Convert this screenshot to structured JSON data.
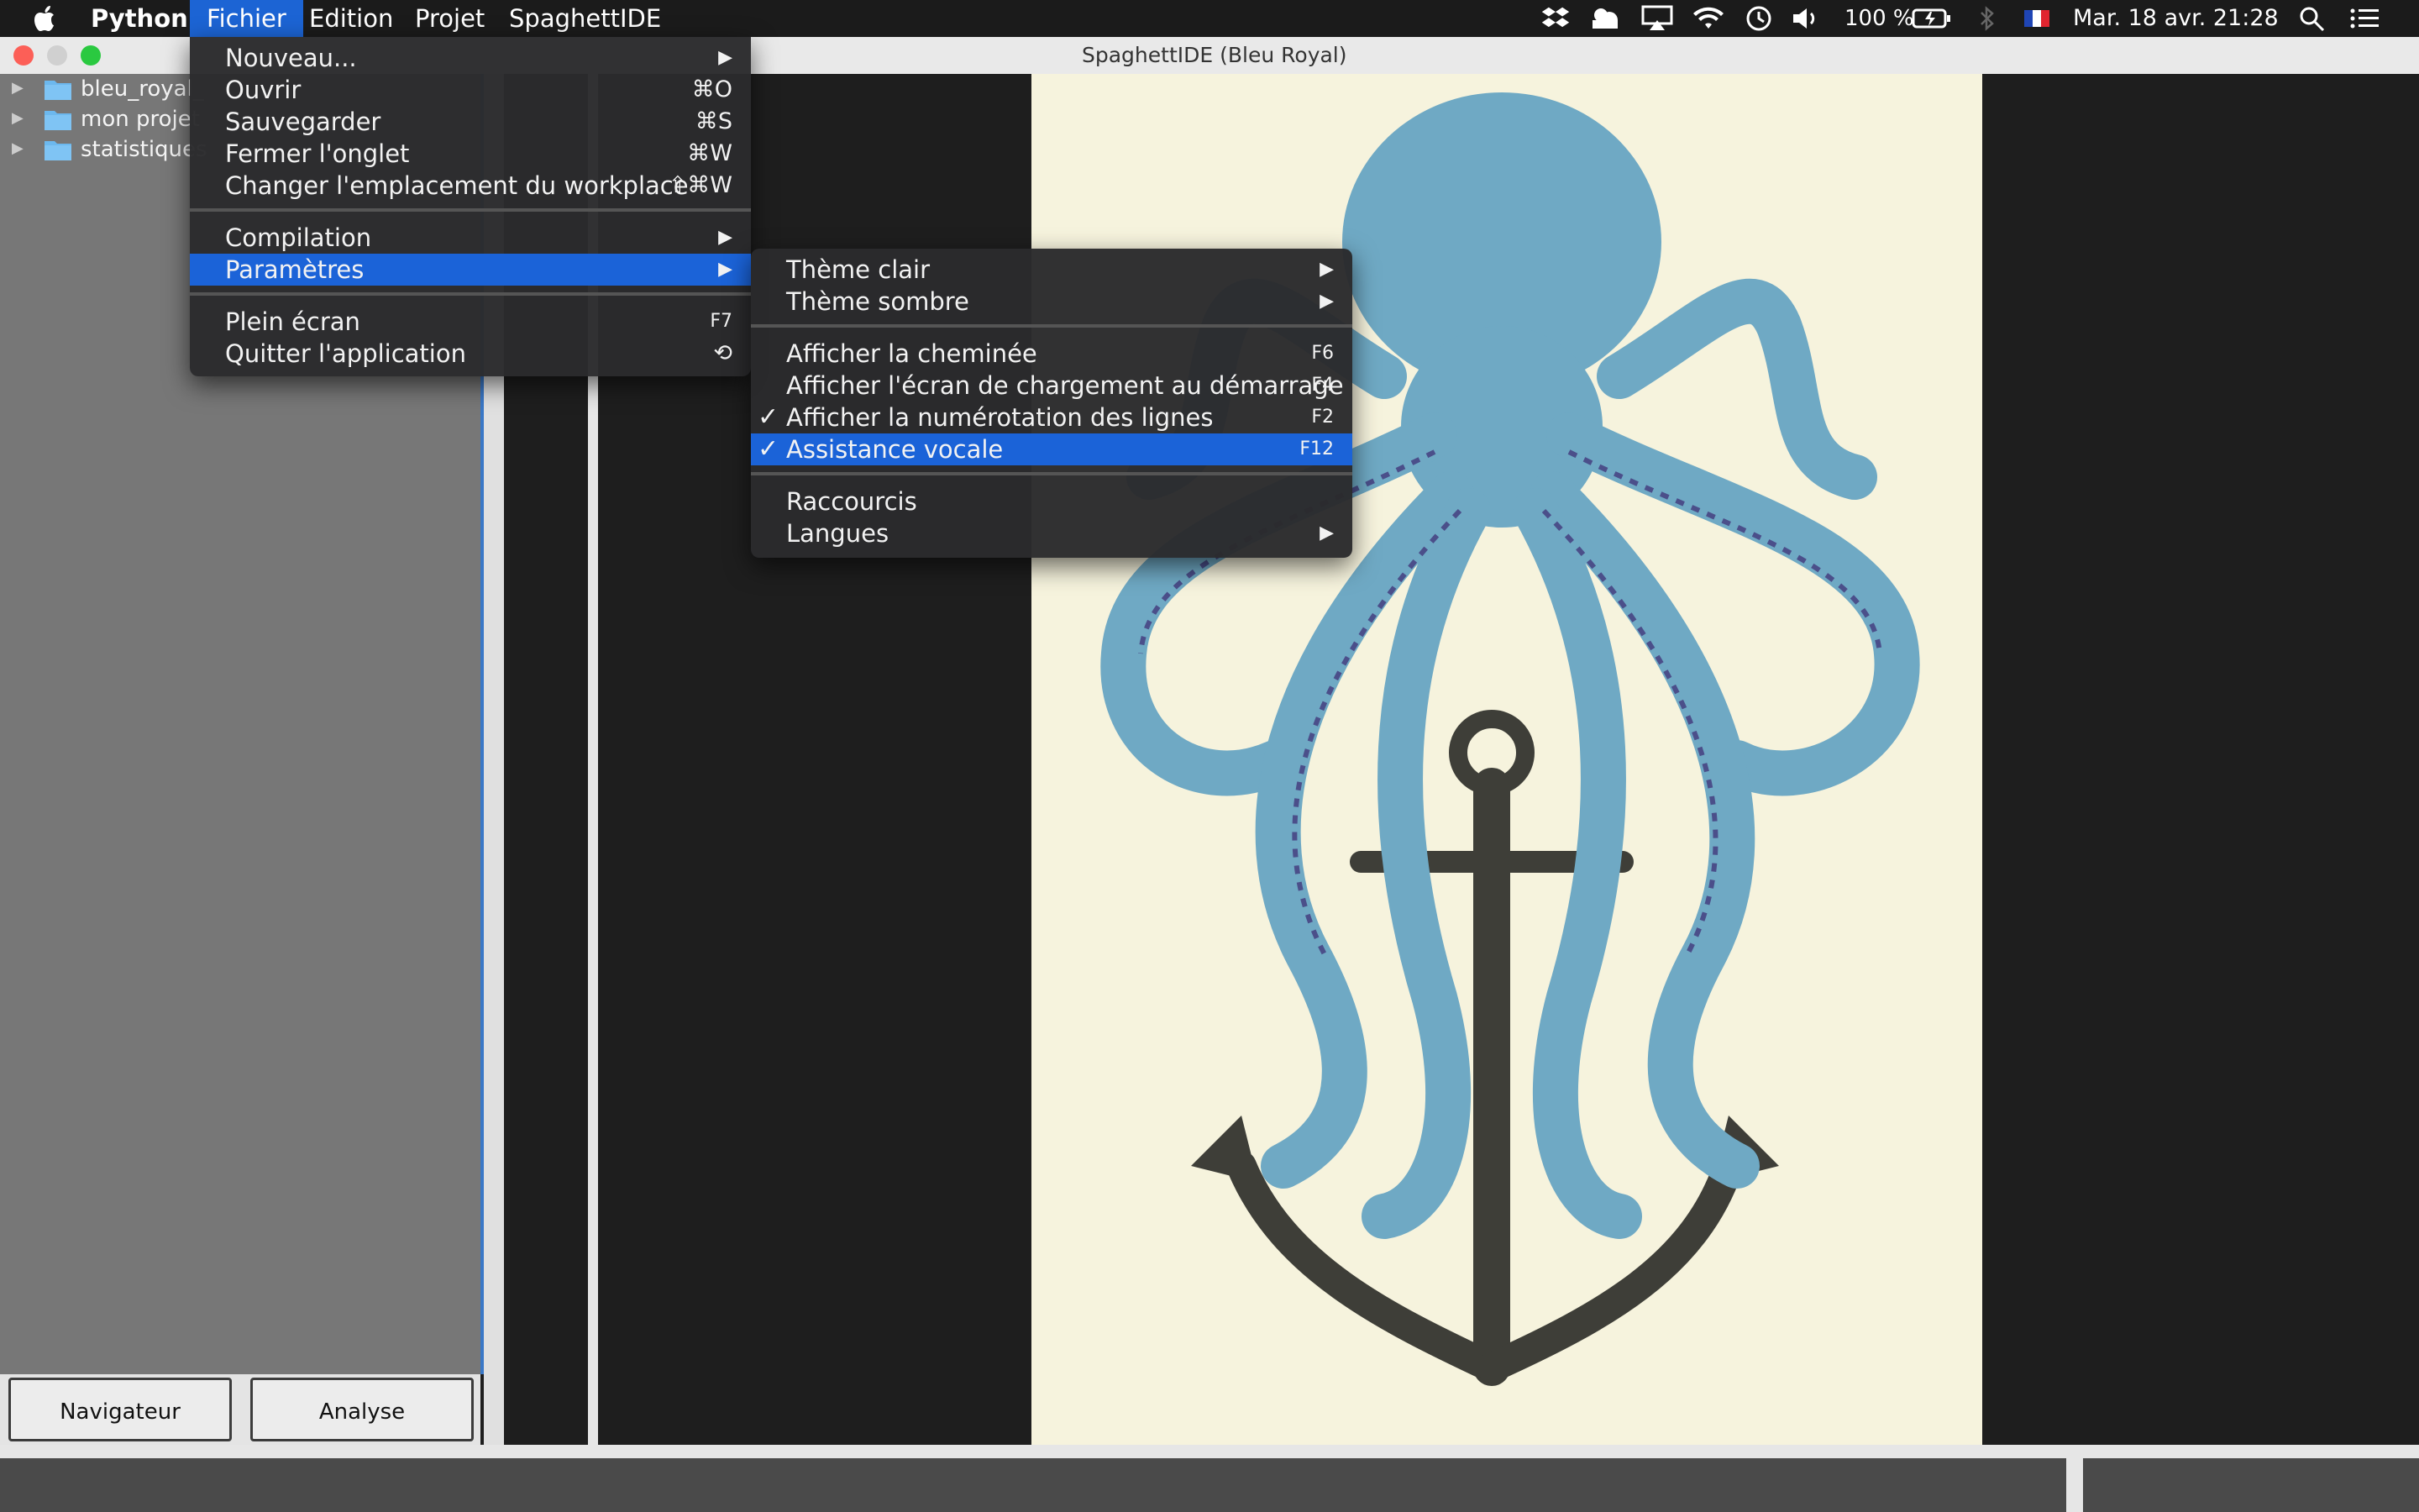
{
  "menubar": {
    "app_name": "Python",
    "menus": [
      "Fichier",
      "Edition",
      "Projet",
      "SpaghettIDE"
    ],
    "battery": "100 %",
    "datetime": "Mar. 18 avr.  21:28",
    "status_icons": [
      "dropbox-icon",
      "cloud-sync-icon",
      "airplay-icon",
      "wifi-icon",
      "time-machine-icon",
      "volume-icon",
      "battery-icon",
      "bluetooth-icon",
      "french-flag-icon",
      "spotlight-icon",
      "notification-center-icon"
    ]
  },
  "window": {
    "title": "SpaghettIDE (Bleu Royal)"
  },
  "sidebar": {
    "items": [
      {
        "label": "bleu_royal_"
      },
      {
        "label": "mon projet"
      },
      {
        "label": "statistiques"
      }
    ],
    "buttons": [
      "Navigateur",
      "Analyse"
    ]
  },
  "fichier_menu": {
    "items": [
      {
        "label": "Nouveau...",
        "shortcut": "",
        "submenu": true
      },
      {
        "label": "Ouvrir",
        "shortcut": "⌘O"
      },
      {
        "label": "Sauvegarder",
        "shortcut": "⌘S"
      },
      {
        "label": "Fermer l'onglet",
        "shortcut": "⌘W"
      },
      {
        "label": "Changer l'emplacement du workplace",
        "shortcut": "⇧⌘W"
      },
      {
        "label": "Compilation",
        "submenu": true
      },
      {
        "label": "Paramètres",
        "submenu": true,
        "highlighted": true
      },
      {
        "label": "Plein écran",
        "shortcut": "F7"
      },
      {
        "label": "Quitter l'application",
        "shortcut": "⟲"
      }
    ]
  },
  "parametres_menu": {
    "items": [
      {
        "label": "Thème clair",
        "submenu": true
      },
      {
        "label": "Thème sombre",
        "submenu": true
      },
      {
        "label": "Afficher la cheminée",
        "shortcut": "F6"
      },
      {
        "label": "Afficher l'écran de chargement au démarrage",
        "shortcut": "F4"
      },
      {
        "label": "Afficher la numérotation des lignes",
        "shortcut": "F2",
        "checked": true
      },
      {
        "label": "Assistance vocale",
        "shortcut": "F12",
        "checked": true,
        "highlighted": true
      },
      {
        "label": "Raccourcis"
      },
      {
        "label": "Langues",
        "submenu": true
      }
    ]
  },
  "symbols": {
    "arrow": "▶",
    "check": "✓",
    "tree_arrow": "▶"
  },
  "colors": {
    "accent": "#1b63d8",
    "menubar_bg": "#1b1b1b",
    "sidebar_bg": "#777777",
    "artwork_bg": "#f6f3dd",
    "octopus": "#6fa9c4",
    "anchor": "#3e3e38"
  }
}
